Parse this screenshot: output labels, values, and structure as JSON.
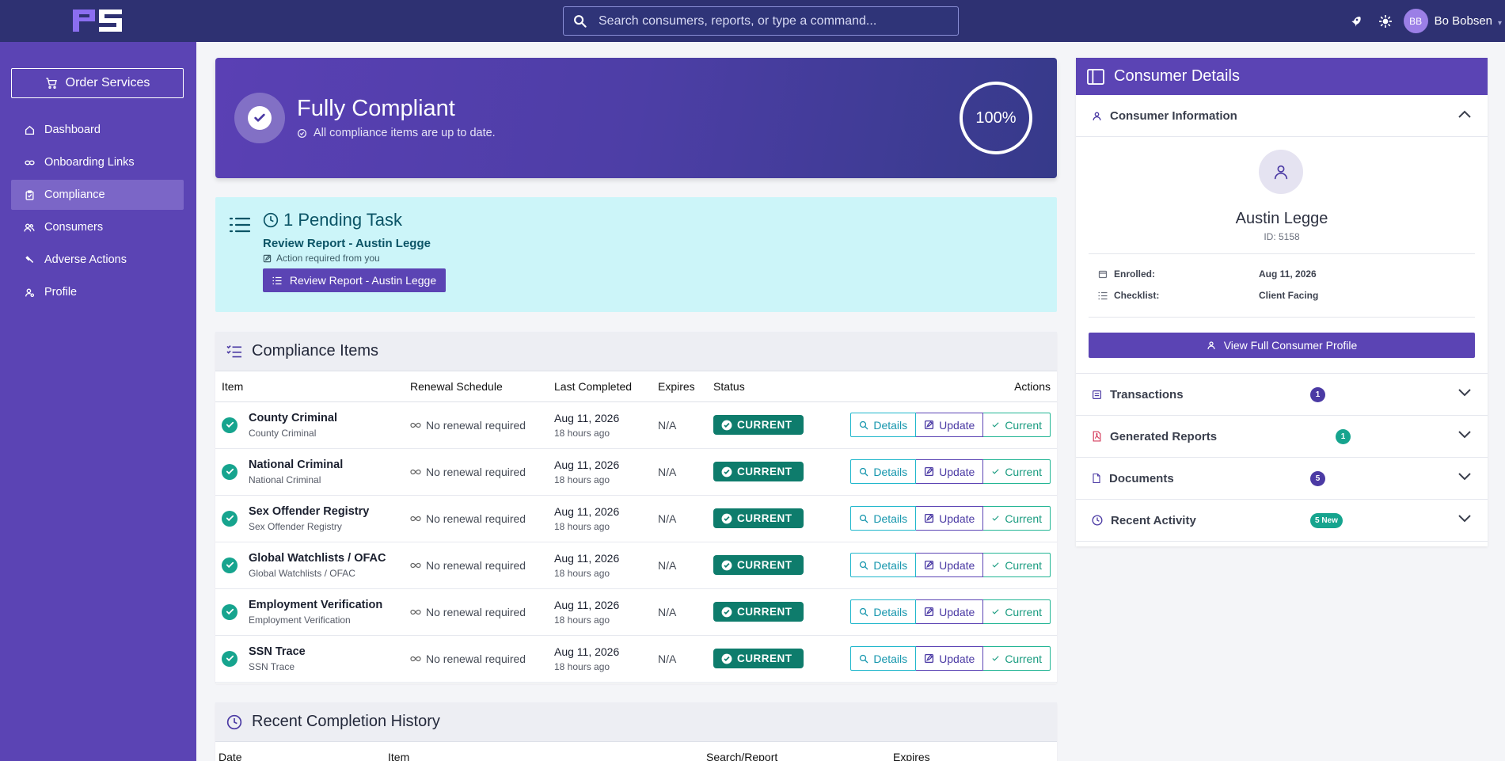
{
  "topbar": {
    "logo_text": "PS",
    "search_placeholder": "Search consumers, reports, or type a command...",
    "icons": [
      "rocket-icon",
      "sun-icon"
    ],
    "user_initials": "BB",
    "user_name": "Bo Bobsen"
  },
  "sidebar": {
    "order_label": "Order Services",
    "items": [
      {
        "label": "Dashboard",
        "icon": "home-icon",
        "active": false
      },
      {
        "label": "Onboarding Links",
        "icon": "link-icon",
        "active": false
      },
      {
        "label": "Compliance",
        "icon": "clipboard-icon",
        "active": true
      },
      {
        "label": "Consumers",
        "icon": "users-icon",
        "active": false
      },
      {
        "label": "Adverse Actions",
        "icon": "gavel-icon",
        "active": false
      },
      {
        "label": "Profile",
        "icon": "user-gear-icon",
        "active": false
      }
    ]
  },
  "banner": {
    "title": "Fully Compliant",
    "subtitle": "All compliance items are up to date.",
    "percent": "100%"
  },
  "pending": {
    "title": "1 Pending Task",
    "task": "Review Report - Austin Legge",
    "note": "Action required from you",
    "button": "Review Report - Austin Legge"
  },
  "compliance": {
    "title": "Compliance Items",
    "headers": {
      "item": "Item",
      "renewal": "Renewal Schedule",
      "last": "Last Completed",
      "expires": "Expires",
      "status": "Status",
      "actions": "Actions"
    },
    "action_labels": {
      "details": "Details",
      "update": "Update",
      "current": "Current"
    },
    "rows": [
      {
        "name": "County Criminal",
        "sub": "County Criminal",
        "renewal": "No renewal required",
        "date": "Aug 11, 2026",
        "ago": "18 hours ago",
        "expires": "N/A",
        "status": "CURRENT"
      },
      {
        "name": "National Criminal",
        "sub": "National Criminal",
        "renewal": "No renewal required",
        "date": "Aug 11, 2026",
        "ago": "18 hours ago",
        "expires": "N/A",
        "status": "CURRENT"
      },
      {
        "name": "Sex Offender Registry",
        "sub": "Sex Offender Registry",
        "renewal": "No renewal required",
        "date": "Aug 11, 2026",
        "ago": "18 hours ago",
        "expires": "N/A",
        "status": "CURRENT"
      },
      {
        "name": "Global Watchlists / OFAC",
        "sub": "Global Watchlists / OFAC",
        "renewal": "No renewal required",
        "date": "Aug 11, 2026",
        "ago": "18 hours ago",
        "expires": "N/A",
        "status": "CURRENT"
      },
      {
        "name": "Employment Verification",
        "sub": "Employment Verification",
        "renewal": "No renewal required",
        "date": "Aug 11, 2026",
        "ago": "18 hours ago",
        "expires": "N/A",
        "status": "CURRENT"
      },
      {
        "name": "SSN Trace",
        "sub": "SSN Trace",
        "renewal": "No renewal required",
        "date": "Aug 11, 2026",
        "ago": "18 hours ago",
        "expires": "N/A",
        "status": "CURRENT"
      }
    ]
  },
  "history": {
    "title": "Recent Completion History",
    "headers": {
      "date": "Date",
      "item": "Item",
      "search": "Search/Report",
      "expires": "Expires"
    }
  },
  "consumer_panel": {
    "title": "Consumer Details",
    "info_label": "Consumer Information",
    "name": "Austin Legge",
    "id_text": "ID: 5158",
    "enrolled_label": "Enrolled:",
    "enrolled_value": "Aug 11, 2026",
    "checklist_label": "Checklist:",
    "checklist_value": "Client Facing",
    "view_button": "View Full Consumer Profile",
    "sections": [
      {
        "label": "Transactions",
        "badge": "1",
        "badge_color": "#4b3aa4"
      },
      {
        "label": "Generated Reports",
        "badge": "1",
        "badge_color": "#16a48e"
      },
      {
        "label": "Documents",
        "badge": "5",
        "badge_color": "#4b3aa4"
      },
      {
        "label": "Recent Activity",
        "badge": "5 New",
        "badge_color": "#16a48e"
      }
    ]
  },
  "colors": {
    "brand": "#5b44b4",
    "topbar": "#2e3172",
    "status": "#0e7c6c",
    "teal": "#16a48e"
  }
}
